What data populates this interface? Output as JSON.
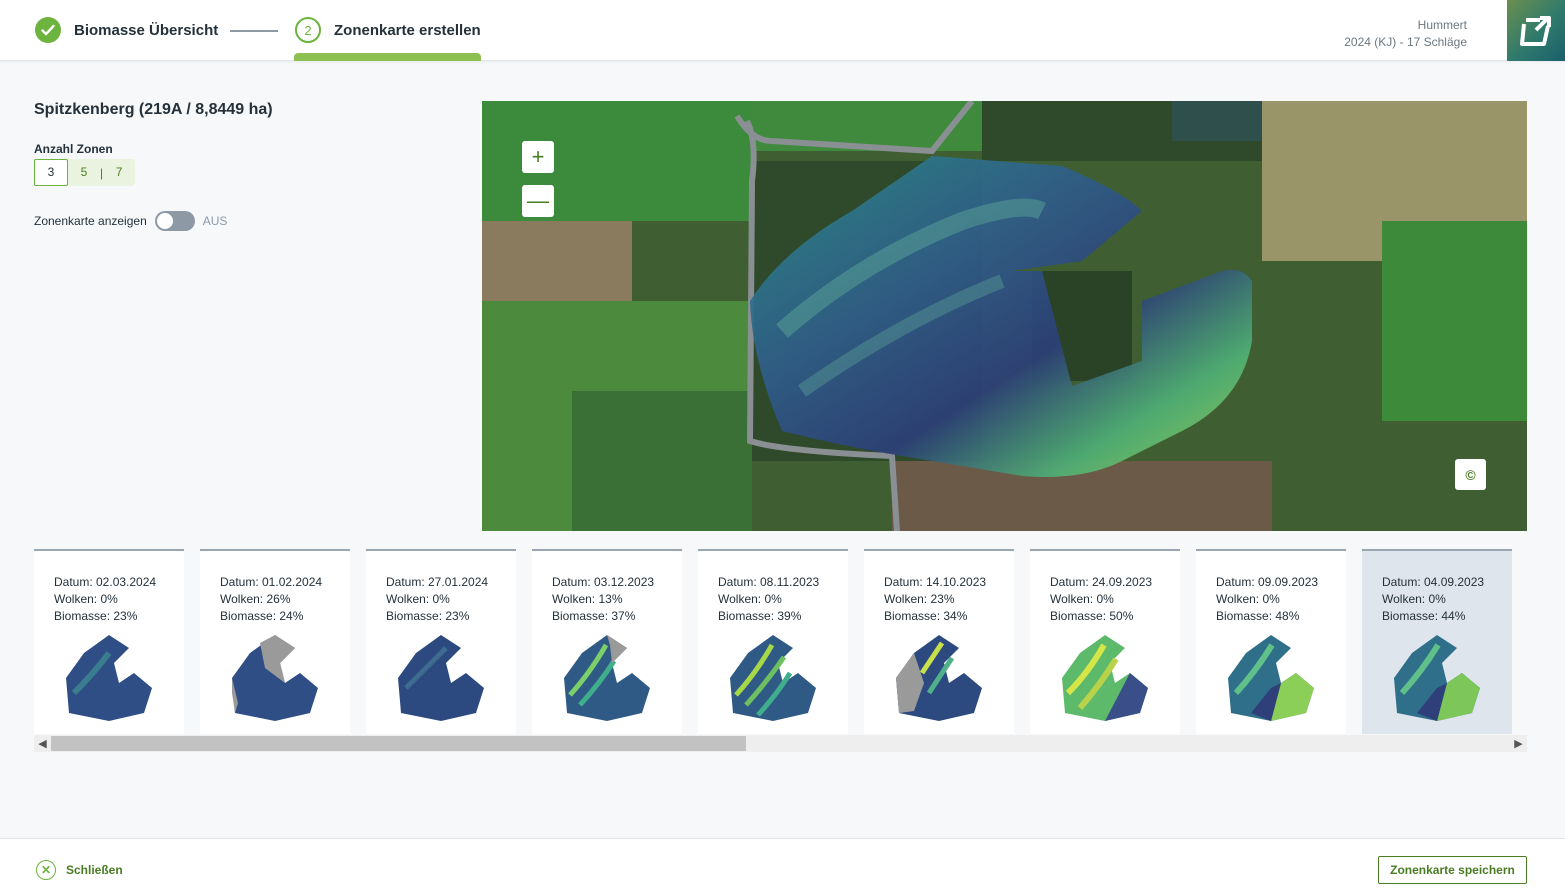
{
  "header": {
    "steps": [
      {
        "label": "Biomasse Übersicht",
        "state": "done"
      },
      {
        "number": "2",
        "label": "Zonenkarte erstellen",
        "state": "active"
      }
    ],
    "account_name": "Hummert",
    "account_detail": "2024 (KJ) - 17 Schläge",
    "brand_icon": "app-logo-icon"
  },
  "panel": {
    "field_title": "Spitzkenberg (219A / 8,8449 ha)",
    "zones_label": "Anzahl Zonen",
    "zone_options": [
      "3",
      "5",
      "7"
    ],
    "zone_selected": "3",
    "toggle_label": "Zonenkarte anzeigen",
    "toggle_state": "AUS"
  },
  "map": {
    "zoom_in": "+",
    "zoom_out": "—",
    "copyright": "©"
  },
  "cards": [
    {
      "date": "Datum: 02.03.2024",
      "clouds": "Wolken: 0%",
      "biomass": "Biomasse: 23%",
      "selected": false
    },
    {
      "date": "Datum: 01.02.2024",
      "clouds": "Wolken: 26%",
      "biomass": "Biomasse: 24%",
      "selected": false
    },
    {
      "date": "Datum: 27.01.2024",
      "clouds": "Wolken: 0%",
      "biomass": "Biomasse: 23%",
      "selected": false
    },
    {
      "date": "Datum: 03.12.2023",
      "clouds": "Wolken: 13%",
      "biomass": "Biomasse: 37%",
      "selected": false
    },
    {
      "date": "Datum: 08.11.2023",
      "clouds": "Wolken: 0%",
      "biomass": "Biomasse: 39%",
      "selected": false
    },
    {
      "date": "Datum: 14.10.2023",
      "clouds": "Wolken: 23%",
      "biomass": "Biomasse: 34%",
      "selected": false
    },
    {
      "date": "Datum: 24.09.2023",
      "clouds": "Wolken: 0%",
      "biomass": "Biomasse: 50%",
      "selected": false
    },
    {
      "date": "Datum: 09.09.2023",
      "clouds": "Wolken: 0%",
      "biomass": "Biomasse: 48%",
      "selected": false
    },
    {
      "date": "Datum: 04.09.2023",
      "clouds": "Wolken: 0%",
      "biomass": "Biomasse: 44%",
      "selected": true
    }
  ],
  "footer": {
    "close_label": "Schließen",
    "save_label": "Zonenkarte speichern"
  },
  "colors": {
    "accent": "#6cb33f",
    "accent_dark": "#4a7d23",
    "selected_card": "#dfe5ed"
  }
}
